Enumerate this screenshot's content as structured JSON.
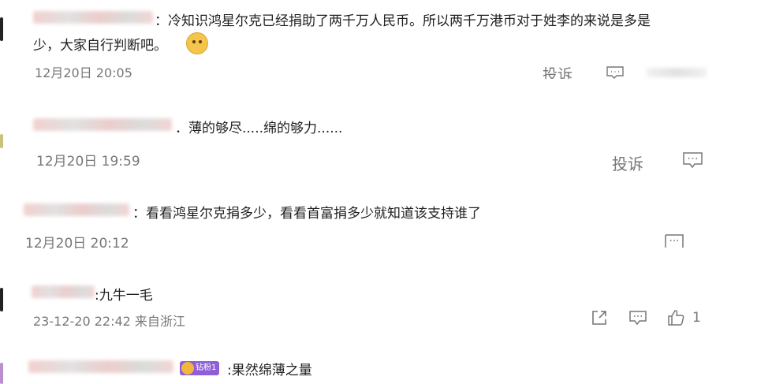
{
  "comments": [
    {
      "text_line1": "：冷知识鸿星尔克已经捐助了两千万人民币。所以两千万港币对于姓李的来说是多是",
      "text_line2": "少，大家自行判断吧。",
      "meta": "12月20日 20:05",
      "report_label": "投诉"
    },
    {
      "text": "．薄的够尽.....绵的够力......",
      "meta": "12月20日 19:59",
      "report_label": "投诉"
    },
    {
      "text": "：看看鸿星尔克捐多少，看看首富捐多少就知道该支持谁了",
      "meta": "12月20日 20:12"
    },
    {
      "text": ":九牛一毛",
      "meta": "23-12-20 22:42 来自浙江",
      "like_count": "1"
    },
    {
      "badge": "钻粉1",
      "text": ":果然绵薄之量"
    }
  ],
  "icons": {
    "comment": "comment-icon",
    "share": "share-icon",
    "like": "thumbs-up-icon",
    "emoji": "doge-emoji-icon"
  }
}
